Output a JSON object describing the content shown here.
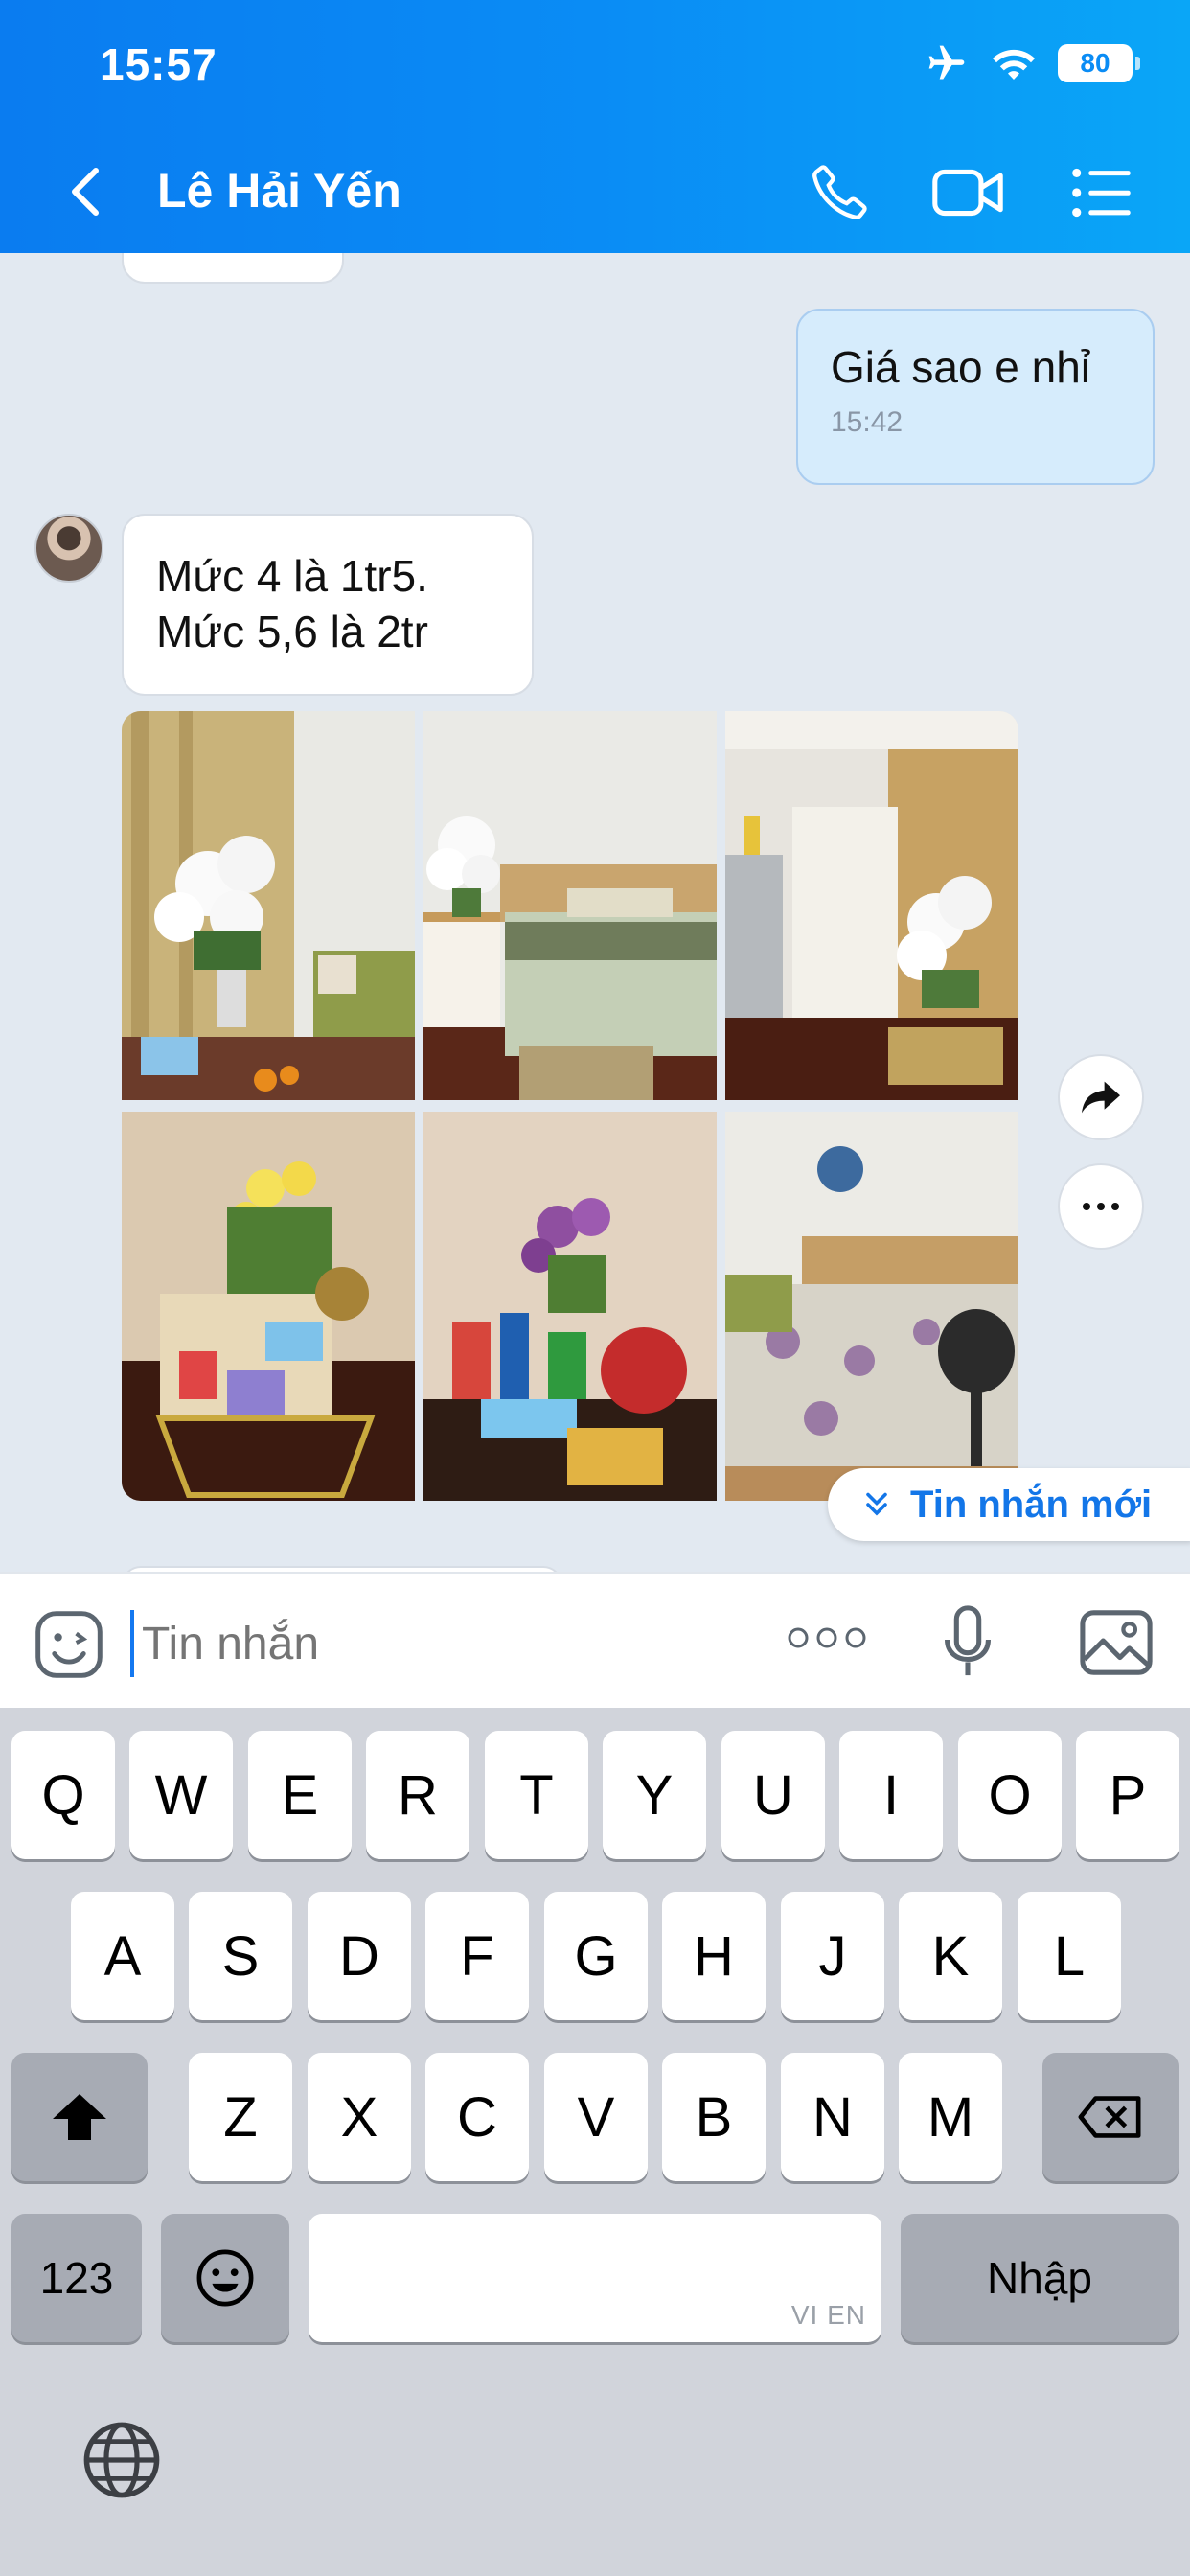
{
  "status_bar": {
    "time": "15:57",
    "battery": "80"
  },
  "header": {
    "contact_name": "Lê Hải Yến"
  },
  "messages": {
    "outgoing_1": {
      "text": "Giá sao e nhỉ",
      "time": "15:42"
    },
    "incoming_1": {
      "line1": "Mức 4 là 1tr5.",
      "line2": "Mức 5,6 là 2tr"
    }
  },
  "new_message_pill": "Tin nhắn mới",
  "input": {
    "placeholder": "Tin nhắn"
  },
  "keyboard": {
    "row1": [
      "Q",
      "W",
      "E",
      "R",
      "T",
      "Y",
      "U",
      "I",
      "O",
      "P"
    ],
    "row2": [
      "A",
      "S",
      "D",
      "F",
      "G",
      "H",
      "J",
      "K",
      "L"
    ],
    "row3": [
      "Z",
      "X",
      "C",
      "V",
      "B",
      "N",
      "M"
    ],
    "numbers_key": "123",
    "return_key": "Nhập",
    "space_lang": "VI EN"
  },
  "colors": {
    "header_start": "#0a7cf0",
    "header_end": "#0aa6f7",
    "outgoing_bubble": "#d6ecfc",
    "accent": "#1376e8"
  }
}
